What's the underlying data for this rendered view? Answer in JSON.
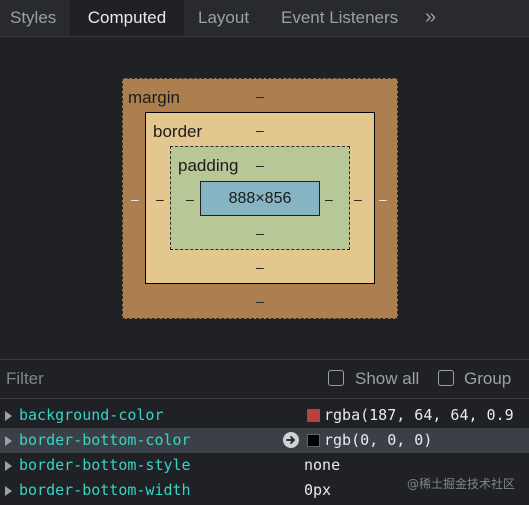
{
  "tabs": [
    {
      "label": "Styles"
    },
    {
      "label": "Computed"
    },
    {
      "label": "Layout"
    },
    {
      "label": "Event Listeners"
    }
  ],
  "more_tabs_glyph": "»",
  "box_model": {
    "margin_label": "margin",
    "border_label": "border",
    "padding_label": "padding",
    "content_size": "888×856",
    "margin_top": "–",
    "margin_bottom": "–",
    "margin_left": "–",
    "margin_right": "–",
    "border_top": "–",
    "border_bottom": "–",
    "border_left": "–",
    "border_right": "–",
    "padding_top": "–",
    "padding_bottom": "–",
    "padding_left": "–",
    "padding_right": "–"
  },
  "filter": {
    "placeholder": "Filter",
    "show_all_label": "Show all",
    "group_label": "Group"
  },
  "properties": [
    {
      "name": "background-color",
      "value": "rgba(187, 64, 64, 0.9",
      "swatch": "#bb4040"
    },
    {
      "name": "border-bottom-color",
      "value": "rgb(0, 0, 0)",
      "swatch": "#000000"
    },
    {
      "name": "border-bottom-style",
      "value": "none"
    },
    {
      "name": "border-bottom-width",
      "value": "0px"
    }
  ],
  "watermark": "@稀土掘金技术社区"
}
